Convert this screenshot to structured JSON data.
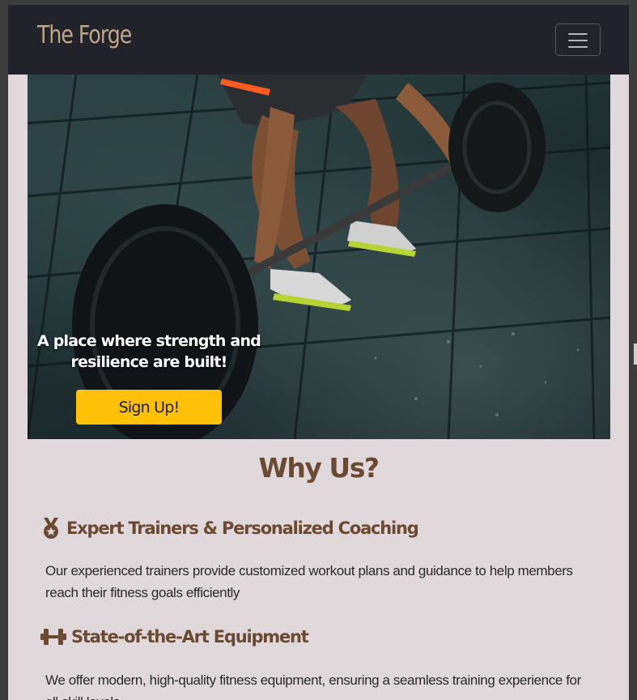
{
  "navbar": {
    "brand": "The Forge",
    "toggle_icon": "hamburger-menu-icon"
  },
  "hero": {
    "caption": "A place where strength and resilience are built!",
    "signup_label": "Sign Up!",
    "image_subject": "athlete lifting a barbell on a gym floor",
    "button_color": "#ffc107"
  },
  "why_us": {
    "title": "Why Us?",
    "features": [
      {
        "icon": "medal-icon",
        "title": "Expert Trainers & Personalized Coaching",
        "text": "Our experienced trainers provide customized workout plans and guidance to help members reach their fitness goals efficiently"
      },
      {
        "icon": "dumbbell-icon",
        "title": "State-of-the-Art Equipment",
        "text": "We offer modern, high-quality fitness equipment, ensuring a seamless training experience for all skill levels."
      }
    ]
  },
  "colors": {
    "navbar_bg": "#22232a",
    "brand": "#bfa58c",
    "page_bg": "#e0d8da",
    "heading": "#6b4a34"
  }
}
